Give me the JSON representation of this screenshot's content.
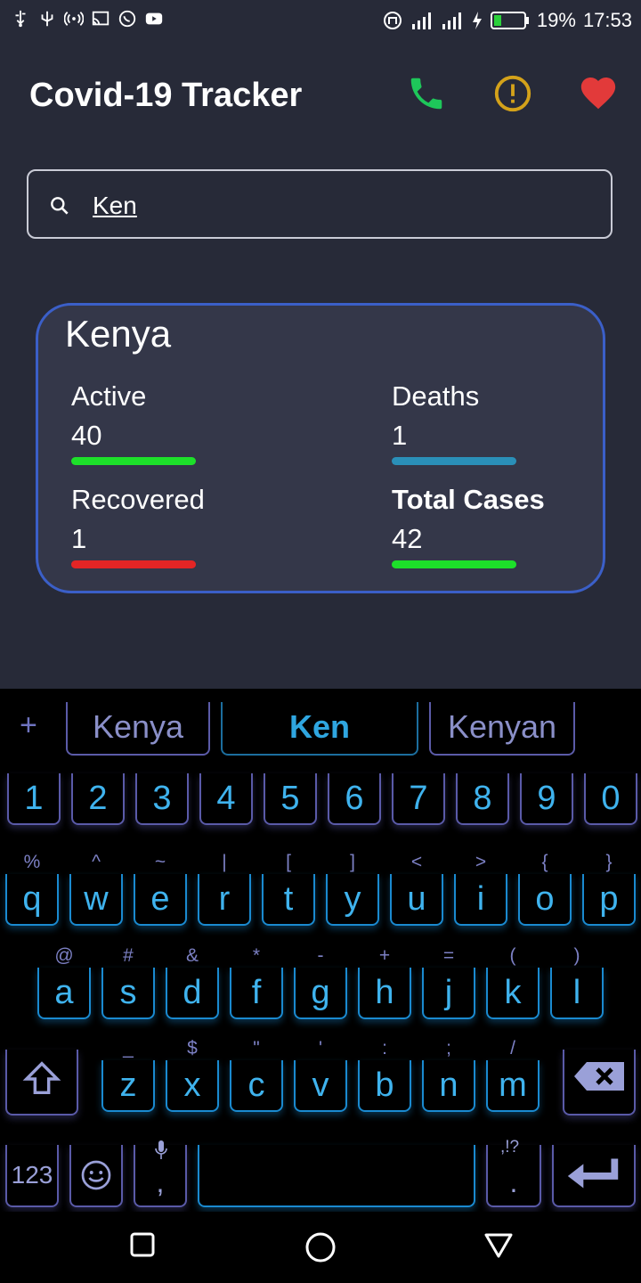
{
  "status_bar": {
    "battery": "19%",
    "time": "17:53"
  },
  "app": {
    "title": "Covid-19 Tracker",
    "icons": [
      "phone-icon",
      "alert-icon",
      "heart-icon"
    ],
    "colors": {
      "phone": "#1ec75a",
      "alert": "#d4a21a",
      "heart": "#e23a3a"
    }
  },
  "search": {
    "value": "Ken",
    "placeholder": ""
  },
  "card": {
    "country": "Kenya",
    "active_label": "Active",
    "active_value": "40",
    "deaths_label": "Deaths",
    "deaths_value": "1",
    "recovered_label": "Recovered",
    "recovered_value": "1",
    "total_label": "Total Cases",
    "total_value": "42",
    "colors": {
      "active": "#1de02a",
      "deaths": "#2a8fb8",
      "recovered": "#e32525",
      "total": "#1de02a"
    }
  },
  "keyboard": {
    "suggestions": [
      "Kenya",
      "Ken",
      "Kenyan"
    ],
    "number_row": [
      "1",
      "2",
      "3",
      "4",
      "5",
      "6",
      "7",
      "8",
      "9",
      "0"
    ],
    "row1": [
      "q",
      "w",
      "e",
      "r",
      "t",
      "y",
      "u",
      "i",
      "o",
      "p"
    ],
    "row1_alt": [
      "%",
      "^",
      "~",
      "|",
      "[",
      "]",
      "<",
      ">",
      "{",
      "}"
    ],
    "row2": [
      "a",
      "s",
      "d",
      "f",
      "g",
      "h",
      "j",
      "k",
      "l"
    ],
    "row2_alt": [
      "@",
      "#",
      "&",
      "*",
      "-",
      "+",
      "=",
      "(",
      ")"
    ],
    "row3": [
      "z",
      "x",
      "c",
      "v",
      "b",
      "n",
      "m"
    ],
    "row3_alt": [
      "_",
      "$",
      "\"",
      "'",
      ":",
      ";",
      "/"
    ],
    "sym_key": "123",
    "comma": ",",
    "period": ".",
    "period_alt": ",!?"
  }
}
